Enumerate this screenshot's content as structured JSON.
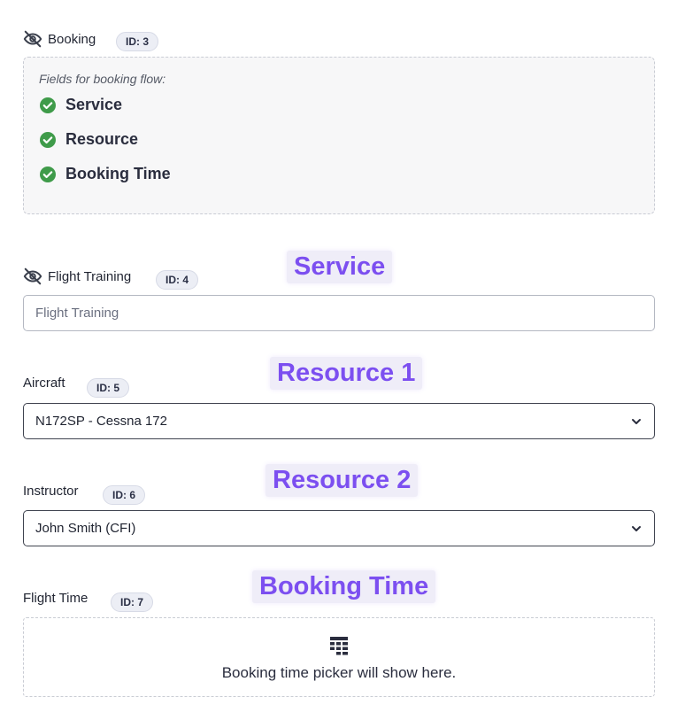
{
  "booking": {
    "label": "Booking",
    "id_badge": "ID: 3",
    "caption": "Fields for booking flow:",
    "items": [
      {
        "label": "Service"
      },
      {
        "label": "Resource"
      },
      {
        "label": "Booking Time"
      }
    ]
  },
  "service_field": {
    "label": "Flight Training",
    "id_badge": "ID: 4",
    "overlay": "Service",
    "value": "Flight Training"
  },
  "aircraft_field": {
    "label": "Aircraft",
    "id_badge": "ID: 5",
    "overlay": "Resource 1",
    "value": "N172SP - Cessna 172"
  },
  "instructor_field": {
    "label": "Instructor",
    "id_badge": "ID: 6",
    "overlay": "Resource 2",
    "value": "John Smith (CFI)"
  },
  "flight_time_field": {
    "label": "Flight Time",
    "id_badge": "ID: 7",
    "overlay": "Booking Time",
    "placeholder_text": "Booking time picker will show here."
  },
  "icons": {
    "hidden": "eye-slash-icon",
    "check": "check-circle-icon",
    "dropdown": "chevron-down-icon",
    "calendar": "calendar-grid-icon"
  },
  "colors": {
    "accent_overlay": "#7c4ff0",
    "check_green": "#3f9b4a",
    "badge_bg": "#eceef5"
  }
}
